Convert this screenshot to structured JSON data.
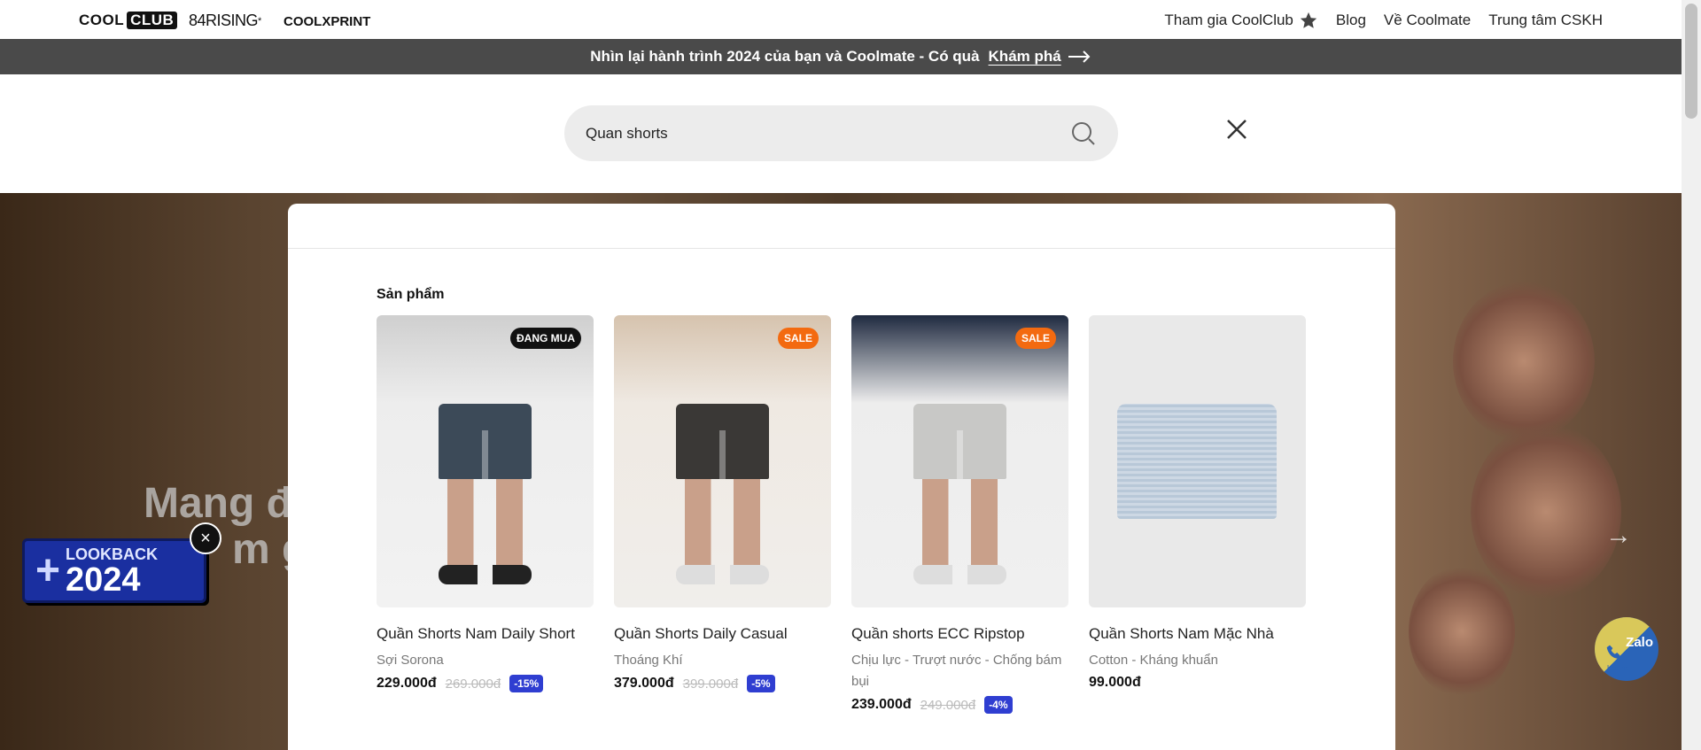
{
  "header": {
    "brand_cool": "COOL",
    "brand_club": "CLUB",
    "brand_84": "84RISING",
    "brand_84_mark": "*",
    "brand_xprint": "COOLXPRINT",
    "nav": [
      {
        "label": "Tham gia CoolClub",
        "icon": "star-icon"
      },
      {
        "label": "Blog"
      },
      {
        "label": "Về Coolmate"
      },
      {
        "label": "Trung tâm CSKH"
      }
    ]
  },
  "promo": {
    "text": "Nhìn lại hành trình 2024 của bạn và Coolmate - Có quà",
    "link": "Khám phá"
  },
  "search": {
    "value": "Quan shorts",
    "icon": "search-icon",
    "close_icon": "close-icon"
  },
  "hero": {
    "text_line1": "Mang đ",
    "text_line2": "m g"
  },
  "lookback": {
    "label": "LOOKBACK",
    "year": "2024"
  },
  "zalo": {
    "label": "Zalo",
    "hotline": "Hotline"
  },
  "results": {
    "section_title": "Sản phẩm",
    "products": [
      {
        "name": "Quần Shorts Nam Daily Short",
        "desc": "Sợi Sorona",
        "price": "229.000đ",
        "old_price": "269.000đ",
        "discount": "-15%",
        "badge": "ĐANG MUA",
        "badge_color": "#111111"
      },
      {
        "name": "Quần Shorts Daily Casual",
        "desc": "Thoáng Khí",
        "price": "379.000đ",
        "old_price": "399.000đ",
        "discount": "-5%",
        "badge": "SALE",
        "badge_color": "#f36a10"
      },
      {
        "name": "Quần shorts ECC Ripstop",
        "desc": "Chịu lực - Trượt nước - Chống bám bụi",
        "price": "239.000đ",
        "old_price": "249.000đ",
        "discount": "-4%",
        "badge": "SALE",
        "badge_color": "#f36a10"
      },
      {
        "name": "Quần Shorts Nam Mặc Nhà",
        "desc": "Cotton - Kháng khuẩn",
        "price": "99.000đ"
      }
    ]
  },
  "colors": {
    "promo_bg": "#4a4a4a",
    "discount_bg": "#2f3ed1",
    "sale_badge": "#f36a10"
  }
}
